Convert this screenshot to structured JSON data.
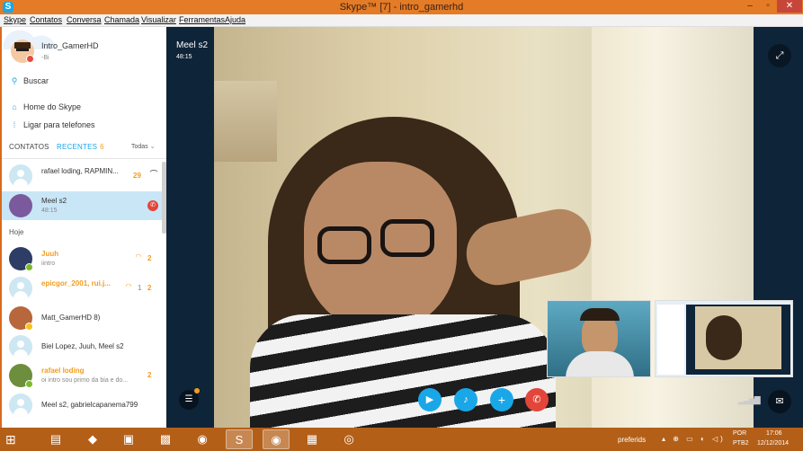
{
  "window": {
    "title": "Skype™ [7] - intro_gamerhd",
    "app_icon": "S",
    "minimize_glyph": "–",
    "maximize_glyph": "▫",
    "close_glyph": "✕"
  },
  "menu": [
    "Skype",
    "Contatos",
    "Conversa",
    "Chamada",
    "Visualizar",
    "Ferramentas",
    "Ajuda"
  ],
  "profile": {
    "name": "Intro_GamerHD",
    "sub": "-Bi",
    "status_color": "#e64b3c"
  },
  "nav": {
    "search": "Buscar",
    "home": "Home do Skype",
    "phones": "Ligar para telefones"
  },
  "tabs": {
    "contacts": "CONTATOS",
    "recent": "RECENTES",
    "recent_count": "6",
    "filter": "Todas"
  },
  "recent": [
    {
      "name": "rafael loding, RAPMIN...",
      "count": "29",
      "icon": "hangup-icon",
      "glyph": "⌒"
    },
    {
      "name": "Meel s2",
      "sub": "48:15",
      "icon": "end-call-icon",
      "glyph": "✆"
    }
  ],
  "section_today": "Hoje",
  "today": [
    {
      "name": "Juuh",
      "sub": "iintro",
      "count": "2",
      "bold": true
    },
    {
      "name": "epicgor_2001, rui.j...",
      "count": "2",
      "missed": "1",
      "bold": true
    },
    {
      "name": "Matt_GamerHD 8)"
    },
    {
      "name": "Biel Lopez, Juuh, Meel s2"
    },
    {
      "name": "rafael loding",
      "sub": "oi intro sou primo da bia e do...",
      "count": "2",
      "bold": true
    },
    {
      "name": "Meel s2, gabrielcapanema799"
    }
  ],
  "call": {
    "caller": "Meel s2",
    "duration": "48:15",
    "expand_glyph": "⤢",
    "video_glyph": "▶",
    "mic_glyph": "♪",
    "add_glyph": "+",
    "hangup_glyph": "✆",
    "chat_list_glyph": "☰",
    "chat_glyph": "✉",
    "signal_glyph": "▂▃▅▇"
  },
  "taskbar": {
    "start_glyph": "⊞",
    "apps": [
      "▤",
      "◆",
      "▣",
      "▩",
      "◉",
      "S",
      "◉",
      "▦",
      "◎"
    ],
    "tray_label": "preferids",
    "tray_icons": "▴ ⊕ ▭ ◐ ◁)",
    "lang_a": "POR",
    "lang_b": "PTB2",
    "time": "17:06",
    "date": "12/12/2014"
  },
  "colors": {
    "skype_blue": "#1aa7e8",
    "orange_accent": "#f29d1e",
    "hangup_red": "#e2463a",
    "selection": "#c9e6f7",
    "window_frame": "#e47b26"
  }
}
